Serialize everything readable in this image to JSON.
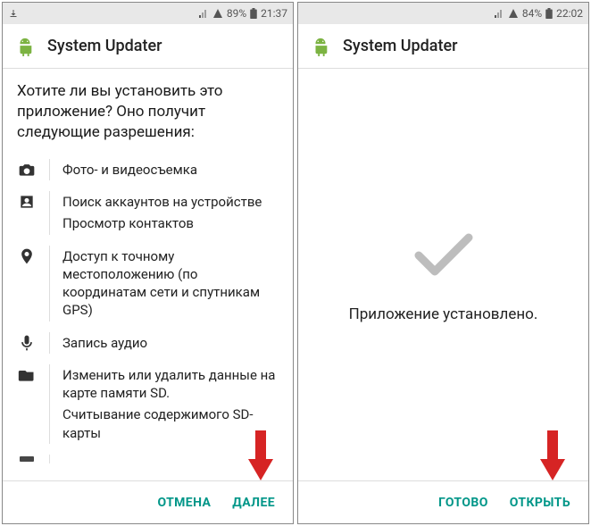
{
  "colors": {
    "accent": "#009688",
    "arrow": "#d62424"
  },
  "left": {
    "status": {
      "battery": "89%",
      "time": "21:37"
    },
    "app_title": "System Updater",
    "prompt": "Хотите ли вы установить это приложение? Оно получит следующие разрешения:",
    "permissions": [
      {
        "icon": "camera-icon",
        "lines": [
          "Фото- и видеосъемка"
        ]
      },
      {
        "icon": "contacts-icon",
        "lines": [
          "Поиск аккаунтов на устройстве",
          "Просмотр контактов"
        ]
      },
      {
        "icon": "location-icon",
        "lines": [
          "Доступ к точному местоположению (по координатам сети и спутникам GPS)"
        ]
      },
      {
        "icon": "microphone-icon",
        "lines": [
          "Запись аудио"
        ]
      },
      {
        "icon": "storage-icon",
        "lines": [
          "Изменить или удалить данные на карте памяти SD.",
          "Считывание содержимого SD-карты"
        ]
      }
    ],
    "buttons": {
      "cancel": "ОТМЕНА",
      "next": "ДАЛЕЕ"
    }
  },
  "right": {
    "status": {
      "battery": "84%",
      "time": "22:02"
    },
    "app_title": "System Updater",
    "installed_text": "Приложение установлено.",
    "buttons": {
      "done": "ГОТОВО",
      "open": "ОТКРЫТЬ"
    }
  }
}
